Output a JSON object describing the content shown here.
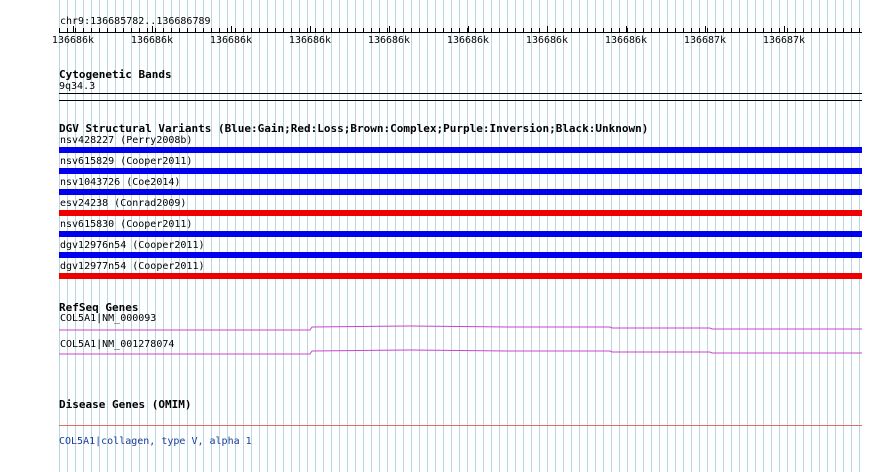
{
  "locus": "chr9:136685782..136686789",
  "ruler_ticks": [
    "136686k",
    "136686k",
    "136686k",
    "136686k",
    "136686k",
    "136686k",
    "136686k",
    "136686k",
    "136687k",
    "136687k"
  ],
  "tracks": {
    "cyto": {
      "title": "Cytogenetic Bands",
      "band": "9q34.3"
    },
    "dgv": {
      "title": "DGV Structural Variants (Blue:Gain;Red:Loss;Brown:Complex;Purple:Inversion;Black:Unknown)",
      "colors": {
        "gain": "#0000ee",
        "loss": "#ee0000"
      },
      "variants": [
        {
          "label": "nsv428227 (Perry2008b)",
          "type": "gain"
        },
        {
          "label": "nsv615829 (Cooper2011)",
          "type": "gain"
        },
        {
          "label": "nsv1043726 (Coe2014)",
          "type": "gain"
        },
        {
          "label": "esv24238 (Conrad2009)",
          "type": "loss"
        },
        {
          "label": "nsv615830 (Cooper2011)",
          "type": "gain"
        },
        {
          "label": "dgv12976n54 (Cooper2011)",
          "type": "gain"
        },
        {
          "label": "dgv12977n54 (Cooper2011)",
          "type": "loss"
        }
      ]
    },
    "refseq": {
      "title": "RefSeq Genes",
      "color": "#cc44cc",
      "genes": [
        {
          "label": "COL5A1|NM_000093"
        },
        {
          "label": "COL5A1|NM_001278074"
        }
      ]
    },
    "omim": {
      "title": "Disease Genes (OMIM)",
      "color": "#e07060",
      "gene_link": "COL5A1",
      "gene_desc": "|collagen, type V, alpha 1"
    }
  }
}
